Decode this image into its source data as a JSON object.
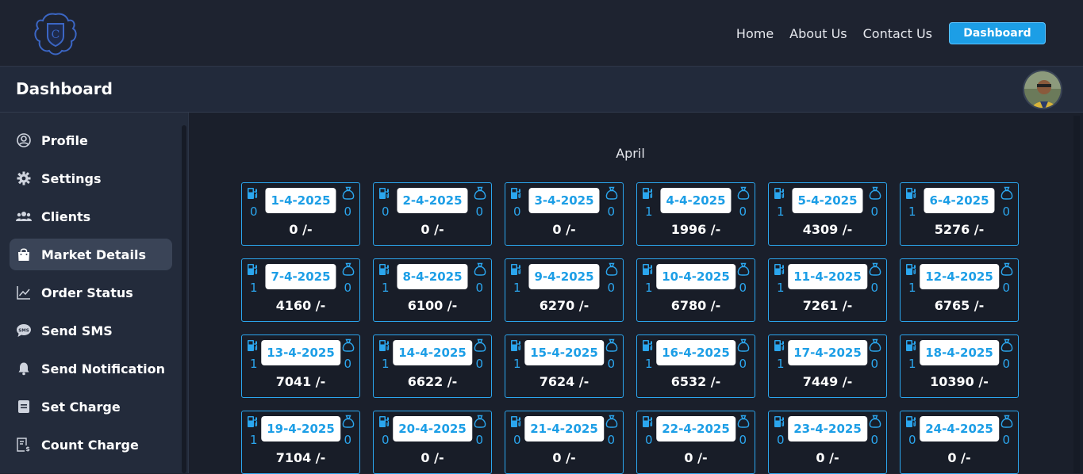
{
  "nav": {
    "home": "Home",
    "about": "About Us",
    "contact": "Contact Us",
    "dashboard_btn": "Dashboard"
  },
  "header": {
    "title": "Dashboard"
  },
  "sidebar": {
    "items": [
      {
        "label": "Profile",
        "icon": "user-circle-icon",
        "active": false
      },
      {
        "label": "Settings",
        "icon": "gear-icon",
        "active": false
      },
      {
        "label": "Clients",
        "icon": "users-icon",
        "active": false
      },
      {
        "label": "Market Details",
        "icon": "shopping-bag-icon",
        "active": true
      },
      {
        "label": "Order Status",
        "icon": "line-chart-icon",
        "active": false
      },
      {
        "label": "Send SMS",
        "icon": "sms-bubble-icon",
        "active": false
      },
      {
        "label": "Send Notification",
        "icon": "bell-icon",
        "active": false
      },
      {
        "label": "Set Charge",
        "icon": "document-icon",
        "active": false
      },
      {
        "label": "Count Charge",
        "icon": "receipt-dollar-icon",
        "active": false
      }
    ]
  },
  "calendar": {
    "month": "April",
    "days": [
      {
        "date": "1-4-2025",
        "left": "0",
        "right": "0",
        "amount": "0 /-"
      },
      {
        "date": "2-4-2025",
        "left": "0",
        "right": "0",
        "amount": "0 /-"
      },
      {
        "date": "3-4-2025",
        "left": "0",
        "right": "0",
        "amount": "0 /-"
      },
      {
        "date": "4-4-2025",
        "left": "1",
        "right": "0",
        "amount": "1996 /-"
      },
      {
        "date": "5-4-2025",
        "left": "1",
        "right": "0",
        "amount": "4309 /-"
      },
      {
        "date": "6-4-2025",
        "left": "1",
        "right": "0",
        "amount": "5276 /-"
      },
      {
        "date": "7-4-2025",
        "left": "1",
        "right": "0",
        "amount": "4160 /-"
      },
      {
        "date": "8-4-2025",
        "left": "1",
        "right": "0",
        "amount": "6100 /-"
      },
      {
        "date": "9-4-2025",
        "left": "1",
        "right": "0",
        "amount": "6270 /-"
      },
      {
        "date": "10-4-2025",
        "left": "1",
        "right": "0",
        "amount": "6780 /-"
      },
      {
        "date": "11-4-2025",
        "left": "1",
        "right": "0",
        "amount": "7261 /-"
      },
      {
        "date": "12-4-2025",
        "left": "1",
        "right": "0",
        "amount": "6765 /-"
      },
      {
        "date": "13-4-2025",
        "left": "1",
        "right": "0",
        "amount": "7041 /-"
      },
      {
        "date": "14-4-2025",
        "left": "1",
        "right": "0",
        "amount": "6622 /-"
      },
      {
        "date": "15-4-2025",
        "left": "1",
        "right": "0",
        "amount": "7624 /-"
      },
      {
        "date": "16-4-2025",
        "left": "1",
        "right": "0",
        "amount": "6532 /-"
      },
      {
        "date": "17-4-2025",
        "left": "1",
        "right": "0",
        "amount": "7449 /-"
      },
      {
        "date": "18-4-2025",
        "left": "1",
        "right": "0",
        "amount": "10390 /-"
      },
      {
        "date": "19-4-2025",
        "left": "1",
        "right": "0",
        "amount": "7104 /-"
      },
      {
        "date": "20-4-2025",
        "left": "0",
        "right": "0",
        "amount": "0 /-"
      },
      {
        "date": "21-4-2025",
        "left": "0",
        "right": "0",
        "amount": "0 /-"
      },
      {
        "date": "22-4-2025",
        "left": "0",
        "right": "0",
        "amount": "0 /-"
      },
      {
        "date": "23-4-2025",
        "left": "0",
        "right": "0",
        "amount": "0 /-"
      },
      {
        "date": "24-4-2025",
        "left": "0",
        "right": "0",
        "amount": "0 /-"
      }
    ]
  },
  "colors": {
    "accent": "#1c9ee6",
    "card_border": "#2ba6ee",
    "bg": "#1e2330"
  }
}
